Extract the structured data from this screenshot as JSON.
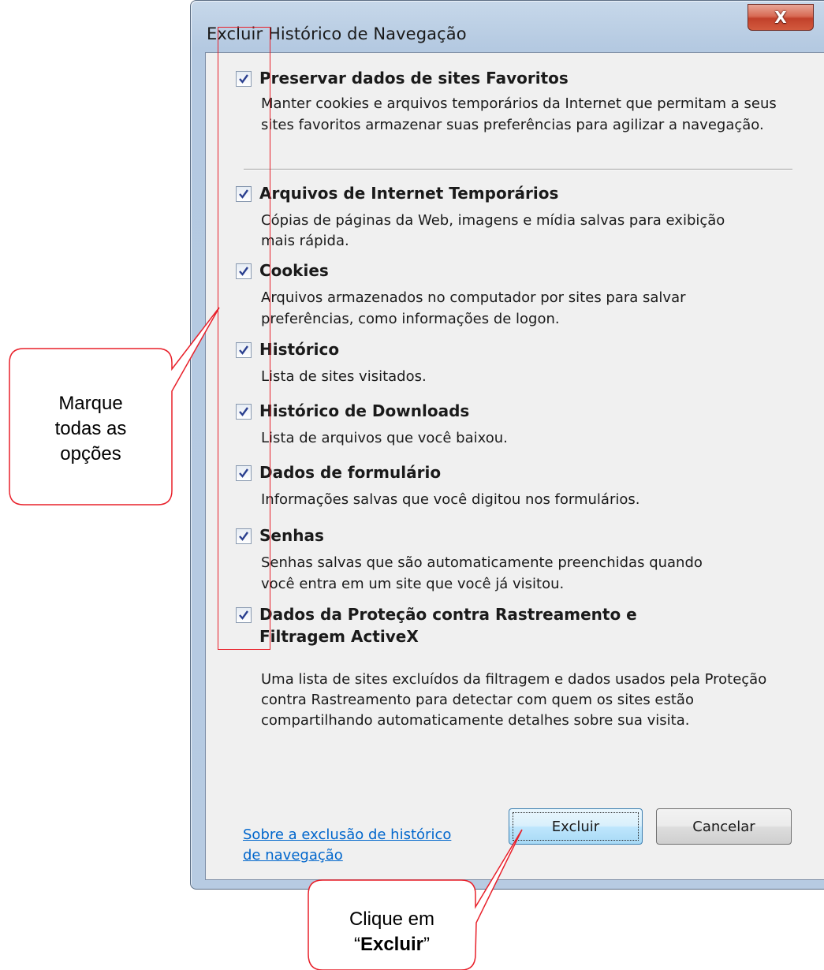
{
  "window": {
    "title": "Excluir Histórico de Navegação",
    "close_glyph": "X"
  },
  "options": [
    {
      "title": "Preservar dados de sites Favoritos",
      "desc": [
        "Manter cookies e arquivos temporários da Internet que permitam a seus",
        "sites favoritos armazenar suas preferências para agilizar a navegação."
      ],
      "checked": true
    },
    {
      "title": "Arquivos de Internet Temporários",
      "desc": [
        "Cópias de páginas da Web, imagens e mídia salvas para exibição",
        "mais rápida."
      ],
      "checked": true
    },
    {
      "title": "Cookies",
      "desc": [
        "Arquivos armazenados no computador por sites para salvar",
        "preferências, como informações de logon."
      ],
      "checked": true
    },
    {
      "title": "Histórico",
      "desc": [
        "Lista de sites visitados."
      ],
      "checked": true
    },
    {
      "title": "Histórico de Downloads",
      "desc": [
        "Lista de arquivos que você baixou."
      ],
      "checked": true
    },
    {
      "title": "Dados de formulário",
      "desc": [
        "Informações salvas que você digitou nos formulários."
      ],
      "checked": true
    },
    {
      "title": "Senhas",
      "desc": [
        "Senhas salvas que são automaticamente preenchidas quando",
        "você entra em um site que você já visitou."
      ],
      "checked": true
    },
    {
      "title": [
        "Dados da Proteção contra Rastreamento e",
        "Filtragem ActiveX"
      ],
      "desc": [
        "Uma lista de sites excluídos da filtragem e dados usados pela Proteção",
        "contra Rastreamento para detectar com quem os sites estão",
        "compartilhando automaticamente detalhes sobre sua visita."
      ],
      "checked": true
    }
  ],
  "footer": {
    "link_lines": [
      "Sobre a exclusão de histórico",
      "de navegação"
    ],
    "delete_button": "Excluir",
    "cancel_button": "Cancelar"
  },
  "annotations": {
    "callout_left": [
      "Marque",
      "todas as",
      "opções"
    ],
    "callout_bottom_line1": "Clique em",
    "callout_bottom_open_quote": "“",
    "callout_bottom_bold": "Excluir",
    "callout_bottom_close_quote": "”",
    "color": "#e8202a"
  },
  "colors": {
    "link": "#0066cc",
    "checkmark": "#2a3f8f",
    "close_button": "#c2412b"
  }
}
